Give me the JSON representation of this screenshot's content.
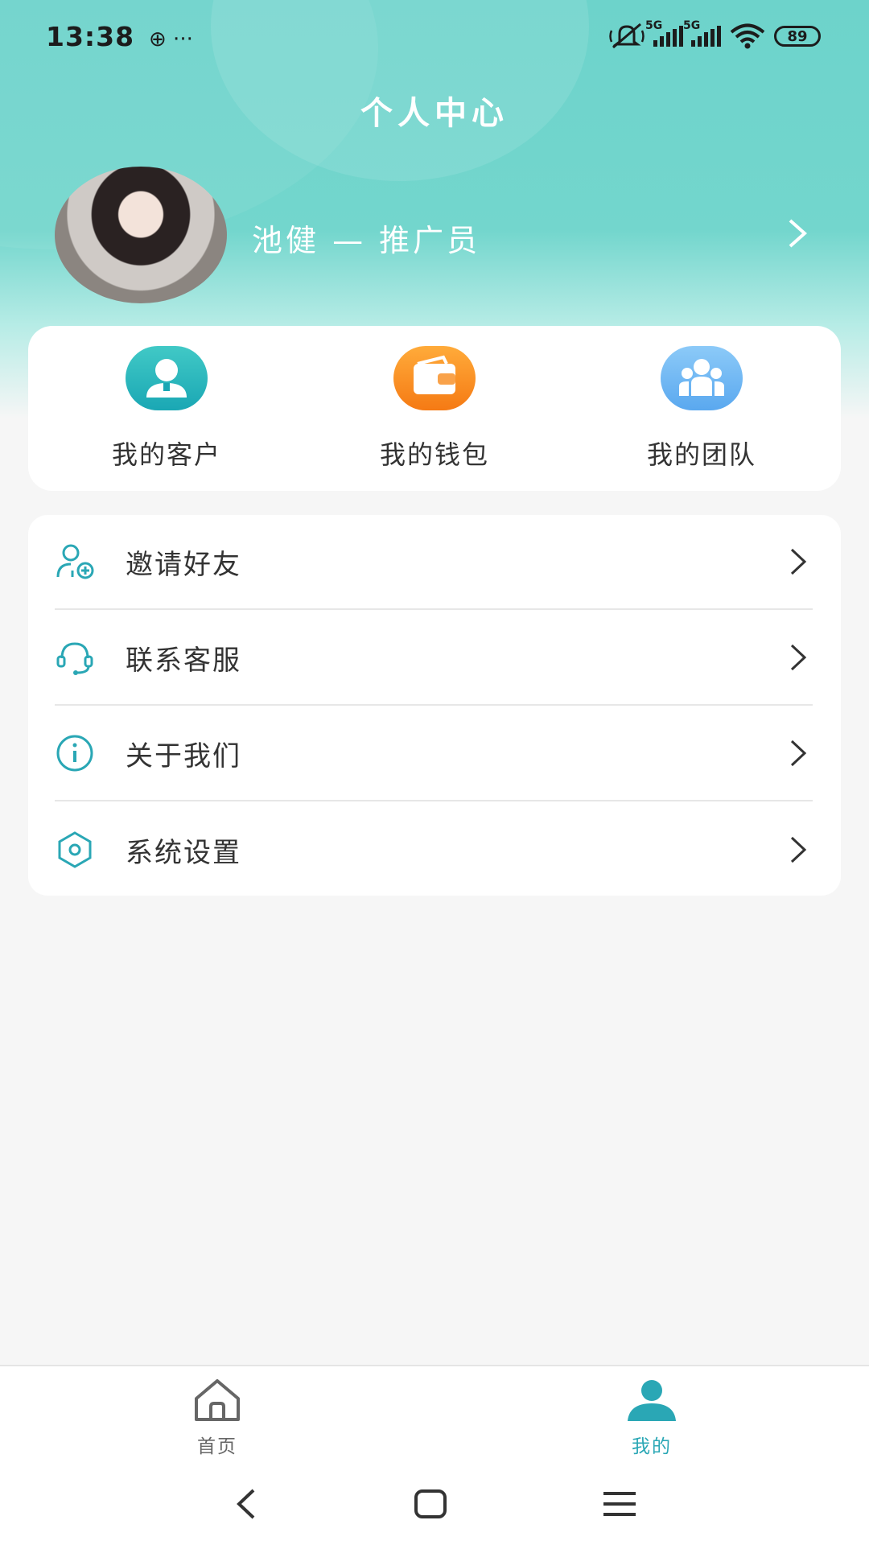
{
  "status_bar": {
    "time": "13:38",
    "left_icons": "⊕  ···",
    "network_1": "5G",
    "network_2": "5G",
    "battery": "89"
  },
  "header": {
    "title": "个人中心"
  },
  "profile": {
    "name": "池健 — 推广员",
    "avatar_icon": "user-photo"
  },
  "quick_actions": [
    {
      "label": "我的客户",
      "icon": "customer-icon",
      "color": "#2bb7be"
    },
    {
      "label": "我的钱包",
      "icon": "wallet-icon",
      "color": "#f78a20"
    },
    {
      "label": "我的团队",
      "icon": "team-icon",
      "color": "#6fb6f5"
    }
  ],
  "menu": [
    {
      "label": "邀请好友",
      "icon": "invite-friend-icon"
    },
    {
      "label": "联系客服",
      "icon": "headset-icon"
    },
    {
      "label": "关于我们",
      "icon": "info-icon"
    },
    {
      "label": "系统设置",
      "icon": "settings-icon"
    }
  ],
  "tabbar": {
    "home_label": "首页",
    "mine_label": "我的",
    "active_color": "#2aa7b5",
    "inactive_color": "#666666"
  },
  "accent_color": "#6dd3cb"
}
